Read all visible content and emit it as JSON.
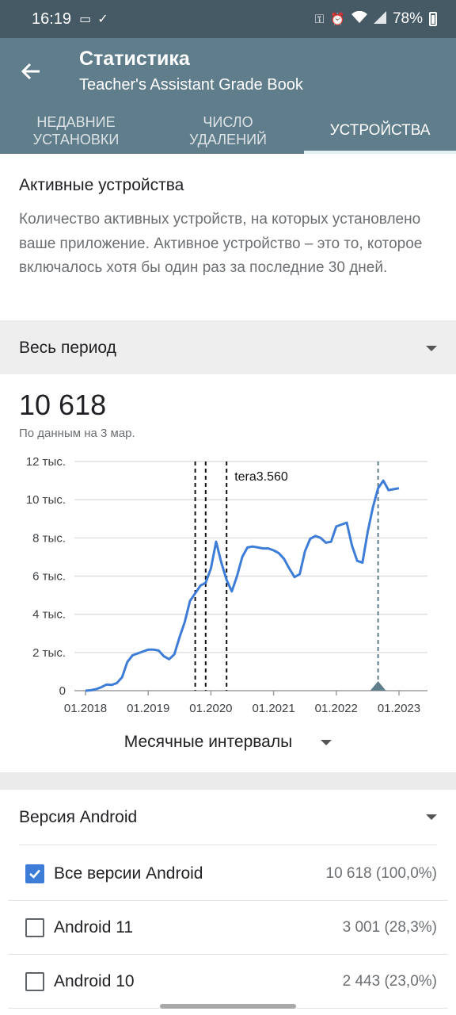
{
  "status": {
    "time": "16:19",
    "battery": "78%"
  },
  "appbar": {
    "title": "Статистика",
    "subtitle": "Teacher's Assistant Grade Book",
    "tabs": [
      {
        "label": "НЕДАВНИЕ УСТАНОВКИ",
        "active": false
      },
      {
        "label": "ЧИСЛО УДАЛЕНИЙ",
        "active": false
      },
      {
        "label": "УСТРОЙСТВА",
        "active": true
      }
    ]
  },
  "active_devices": {
    "heading": "Активные устройства",
    "description": "Количество активных устройств, на которых установлено ваше приложение. Активное устройство – это то, которое включалось хотя бы один раз за последние 30 дней."
  },
  "period": {
    "selected": "Весь период"
  },
  "summary": {
    "total": "10 618",
    "as_of": "По данным на 3 мар."
  },
  "interval": {
    "selected": "Месячные интервалы"
  },
  "chart_data": {
    "type": "line",
    "title": "",
    "ylim": [
      0,
      12000
    ],
    "y_ticks": [
      {
        "value": 0,
        "label": "0"
      },
      {
        "value": 2000,
        "label": "2 тыс."
      },
      {
        "value": 4000,
        "label": "4 тыс."
      },
      {
        "value": 6000,
        "label": "6 тыс."
      },
      {
        "value": 8000,
        "label": "8 тыс."
      },
      {
        "value": 10000,
        "label": "10 тыс."
      },
      {
        "value": 12000,
        "label": "12 тыс."
      }
    ],
    "x_ticks": [
      "01.2018",
      "01.2019",
      "01.2020",
      "01.2021",
      "01.2022",
      "01.2023"
    ],
    "grid": true,
    "color": "#3d7dd8",
    "x": [
      "2018-01",
      "2018-02",
      "2018-03",
      "2018-04",
      "2018-05",
      "2018-06",
      "2018-07",
      "2018-08",
      "2018-09",
      "2018-10",
      "2018-11",
      "2018-12",
      "2019-01",
      "2019-02",
      "2019-03",
      "2019-04",
      "2019-05",
      "2019-06",
      "2019-07",
      "2019-08",
      "2019-09",
      "2019-10",
      "2019-11",
      "2019-12",
      "2020-01",
      "2020-02",
      "2020-03",
      "2020-04",
      "2020-05",
      "2020-06",
      "2020-07",
      "2020-08",
      "2020-09",
      "2020-10",
      "2020-11",
      "2020-12",
      "2021-01",
      "2021-02",
      "2021-03",
      "2021-04",
      "2021-05",
      "2021-06",
      "2021-07",
      "2021-08",
      "2021-09",
      "2021-10",
      "2021-11",
      "2021-12",
      "2022-01",
      "2022-02",
      "2022-03",
      "2022-04",
      "2022-05",
      "2022-06",
      "2022-07",
      "2022-08",
      "2022-09",
      "2022-10",
      "2022-11",
      "2022-12",
      "2023-01",
      "2023-02",
      "2023-03"
    ],
    "values": [
      0,
      20,
      80,
      180,
      320,
      300,
      400,
      700,
      1500,
      1850,
      1950,
      2050,
      2150,
      2150,
      2100,
      1800,
      1650,
      1900,
      2800,
      3600,
      4700,
      5100,
      5500,
      5650,
      6400,
      7800,
      6700,
      5800,
      5200,
      6000,
      7000,
      7500,
      7550,
      7500,
      7450,
      7450,
      7350,
      7200,
      6900,
      6400,
      5950,
      6100,
      7300,
      7950,
      8100,
      8000,
      7750,
      7800,
      8600,
      8700,
      8800,
      7600,
      6800,
      6700,
      8300,
      9600,
      10600,
      11000,
      10500,
      10550,
      10600
    ],
    "markers": [
      {
        "x": "2019-10",
        "style": "dashed",
        "label": ""
      },
      {
        "x": "2019-12",
        "style": "dashed",
        "label": ""
      },
      {
        "x": "2020-04",
        "style": "dashed",
        "label": "tera3.560"
      },
      {
        "x": "2022-09",
        "style": "dashed-gray",
        "label": ""
      }
    ]
  },
  "android": {
    "heading": "Версия Android",
    "rows": [
      {
        "label": "Все версии Android",
        "value": "10 618 (100,0%)",
        "checked": true
      },
      {
        "label": "Android 11",
        "value": "3 001 (28,3%)",
        "checked": false
      },
      {
        "label": "Android 10",
        "value": "2 443 (23,0%)",
        "checked": false
      }
    ]
  }
}
